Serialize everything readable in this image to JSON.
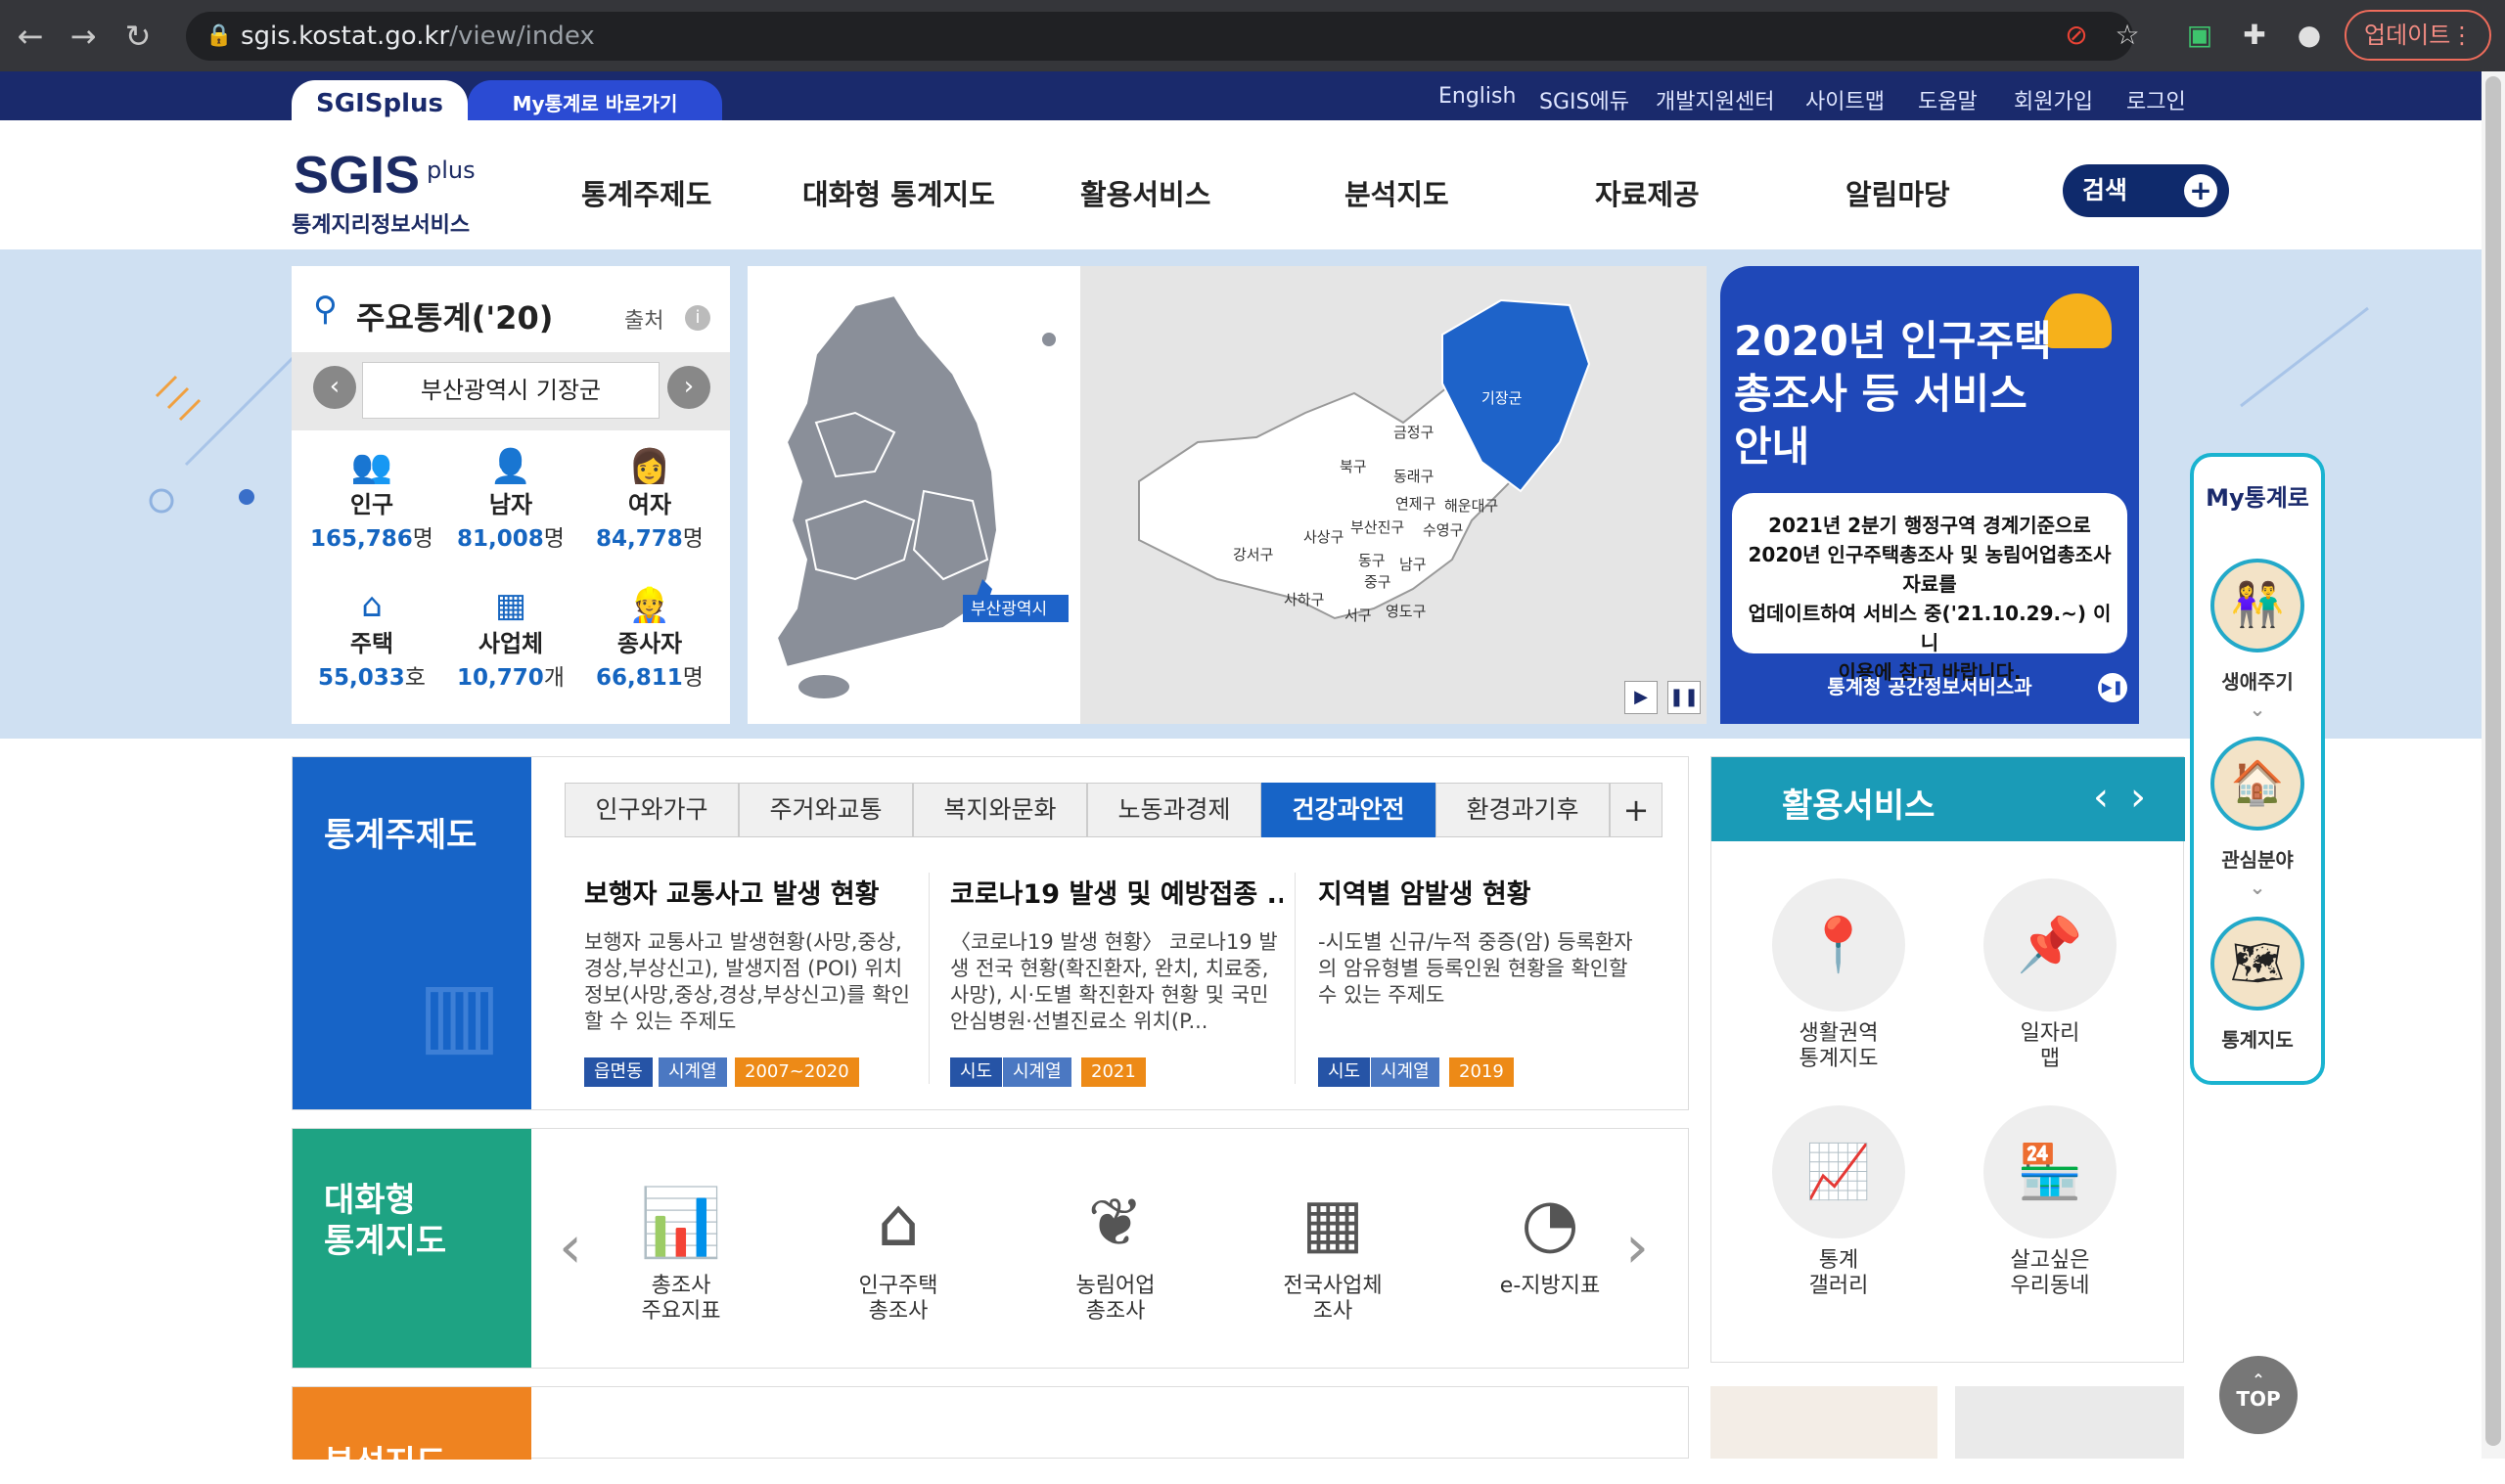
{
  "browser": {
    "url_host": "sgis.kostat.go.kr",
    "url_path": "/view/index",
    "update_label": "업데이트"
  },
  "top_tabs": {
    "sgis": "SGISplus",
    "my": "My통계로 바로가기"
  },
  "top_links": [
    "English",
    "SGIS에듀",
    "개발지원센터",
    "사이트맵",
    "도움말",
    "회원가입",
    "로그인"
  ],
  "logo": {
    "main": "SGIS",
    "plus": "plus",
    "sub": "통계지리정보서비스"
  },
  "menu": [
    "통계주제도",
    "대화형 통계지도",
    "활용서비스",
    "분석지도",
    "자료제공",
    "알림마당"
  ],
  "search_label": "검색",
  "stats": {
    "title": "주요통계('20)",
    "source": "출처",
    "region": "부산광역시 기장군",
    "items": [
      {
        "label": "인구",
        "value": "165,786",
        "unit": "명",
        "icon": "population-icon"
      },
      {
        "label": "남자",
        "value": "81,008",
        "unit": "명",
        "icon": "male-icon"
      },
      {
        "label": "여자",
        "value": "84,778",
        "unit": "명",
        "icon": "female-icon"
      },
      {
        "label": "주택",
        "value": "55,033",
        "unit": "호",
        "icon": "house-icon"
      },
      {
        "label": "사업체",
        "value": "10,770",
        "unit": "개",
        "icon": "building-icon"
      },
      {
        "label": "종사자",
        "value": "66,811",
        "unit": "명",
        "icon": "worker-icon"
      }
    ]
  },
  "map": {
    "busan_label": "부산광역시",
    "districts": [
      "기장군",
      "금정구",
      "북구",
      "동래구",
      "연제구",
      "해운대구",
      "부산진구",
      "수영구",
      "사상구",
      "강서구",
      "동구",
      "남구",
      "중구",
      "사하구",
      "서구",
      "영도구"
    ]
  },
  "notice": {
    "title": "2020년 인구주택총조사 등 서비스 안내",
    "body": [
      "2021년 2분기 행정구역 경계기준으로",
      "2020년 인구주택총조사 및 농림어업총조사 자료를",
      "업데이트하여 서비스 중('21.10.29.~) 이니",
      "이용에 참고 바랍니다."
    ],
    "footer": "통계청 공간정보서비스과"
  },
  "my_bar": {
    "title": "My통계로",
    "items": [
      "생애주기",
      "관심분야",
      "통계지도"
    ]
  },
  "themes": {
    "side_title": "통계주제도",
    "tabs": [
      "인구와가구",
      "주거와교통",
      "복지와문화",
      "노동과경제",
      "건강과안전",
      "환경과기후"
    ],
    "active_tab": "건강과안전",
    "cards": [
      {
        "title": "보행자 교통사고 발생 현황",
        "desc": "보행자 교통사고 발생현황(사망,중상,경상,부상신고), 발생지점 (POI) 위치 정보(사망,중상,경상,부상신고)를 확인할 수 있는 주제도",
        "tags": [
          "읍면동",
          "시계열",
          "2007~2020"
        ]
      },
      {
        "title": "코로나19 발생 및 예방접종 ...",
        "desc": "〈코로나19 발생 현황〉 코로나19 발생 전국 현황(확진환자, 완치, 치료중, 사망), 시·도별 확진환자 현황 및 국민안심병원·선별진료소 위치(P...",
        "tags": [
          "시도",
          "시계열",
          "2021"
        ]
      },
      {
        "title": "지역별 암발생 현황",
        "desc": "-시도별 신규/누적 중증(암) 등록환자의 암유형별 등록인원 현황을 확인할 수 있는 주제도",
        "tags": [
          "시도",
          "시계열",
          "2019"
        ]
      }
    ]
  },
  "interactive": {
    "side_title_1": "대화형",
    "side_title_2": "통계지도",
    "items": [
      {
        "l1": "총조사",
        "l2": "주요지표",
        "icon": "bar-chart-icon"
      },
      {
        "l1": "인구주택",
        "l2": "총조사",
        "icon": "house-person-icon"
      },
      {
        "l1": "농림어업",
        "l2": "총조사",
        "icon": "plant-icon"
      },
      {
        "l1": "전국사업체",
        "l2": "조사",
        "icon": "office-icon"
      },
      {
        "l1": "e-지방지표",
        "l2": "",
        "icon": "pie-chart-icon"
      }
    ]
  },
  "services": {
    "title": "활용서비스",
    "items": [
      {
        "l1": "생활권역",
        "l2": "통계지도"
      },
      {
        "l1": "일자리",
        "l2": "맵"
      },
      {
        "l1": "통계",
        "l2": "갤러리"
      },
      {
        "l1": "살고싶은",
        "l2": "우리동네"
      }
    ]
  },
  "analysis": {
    "side_title": "분석지도"
  },
  "top_button": "TOP"
}
